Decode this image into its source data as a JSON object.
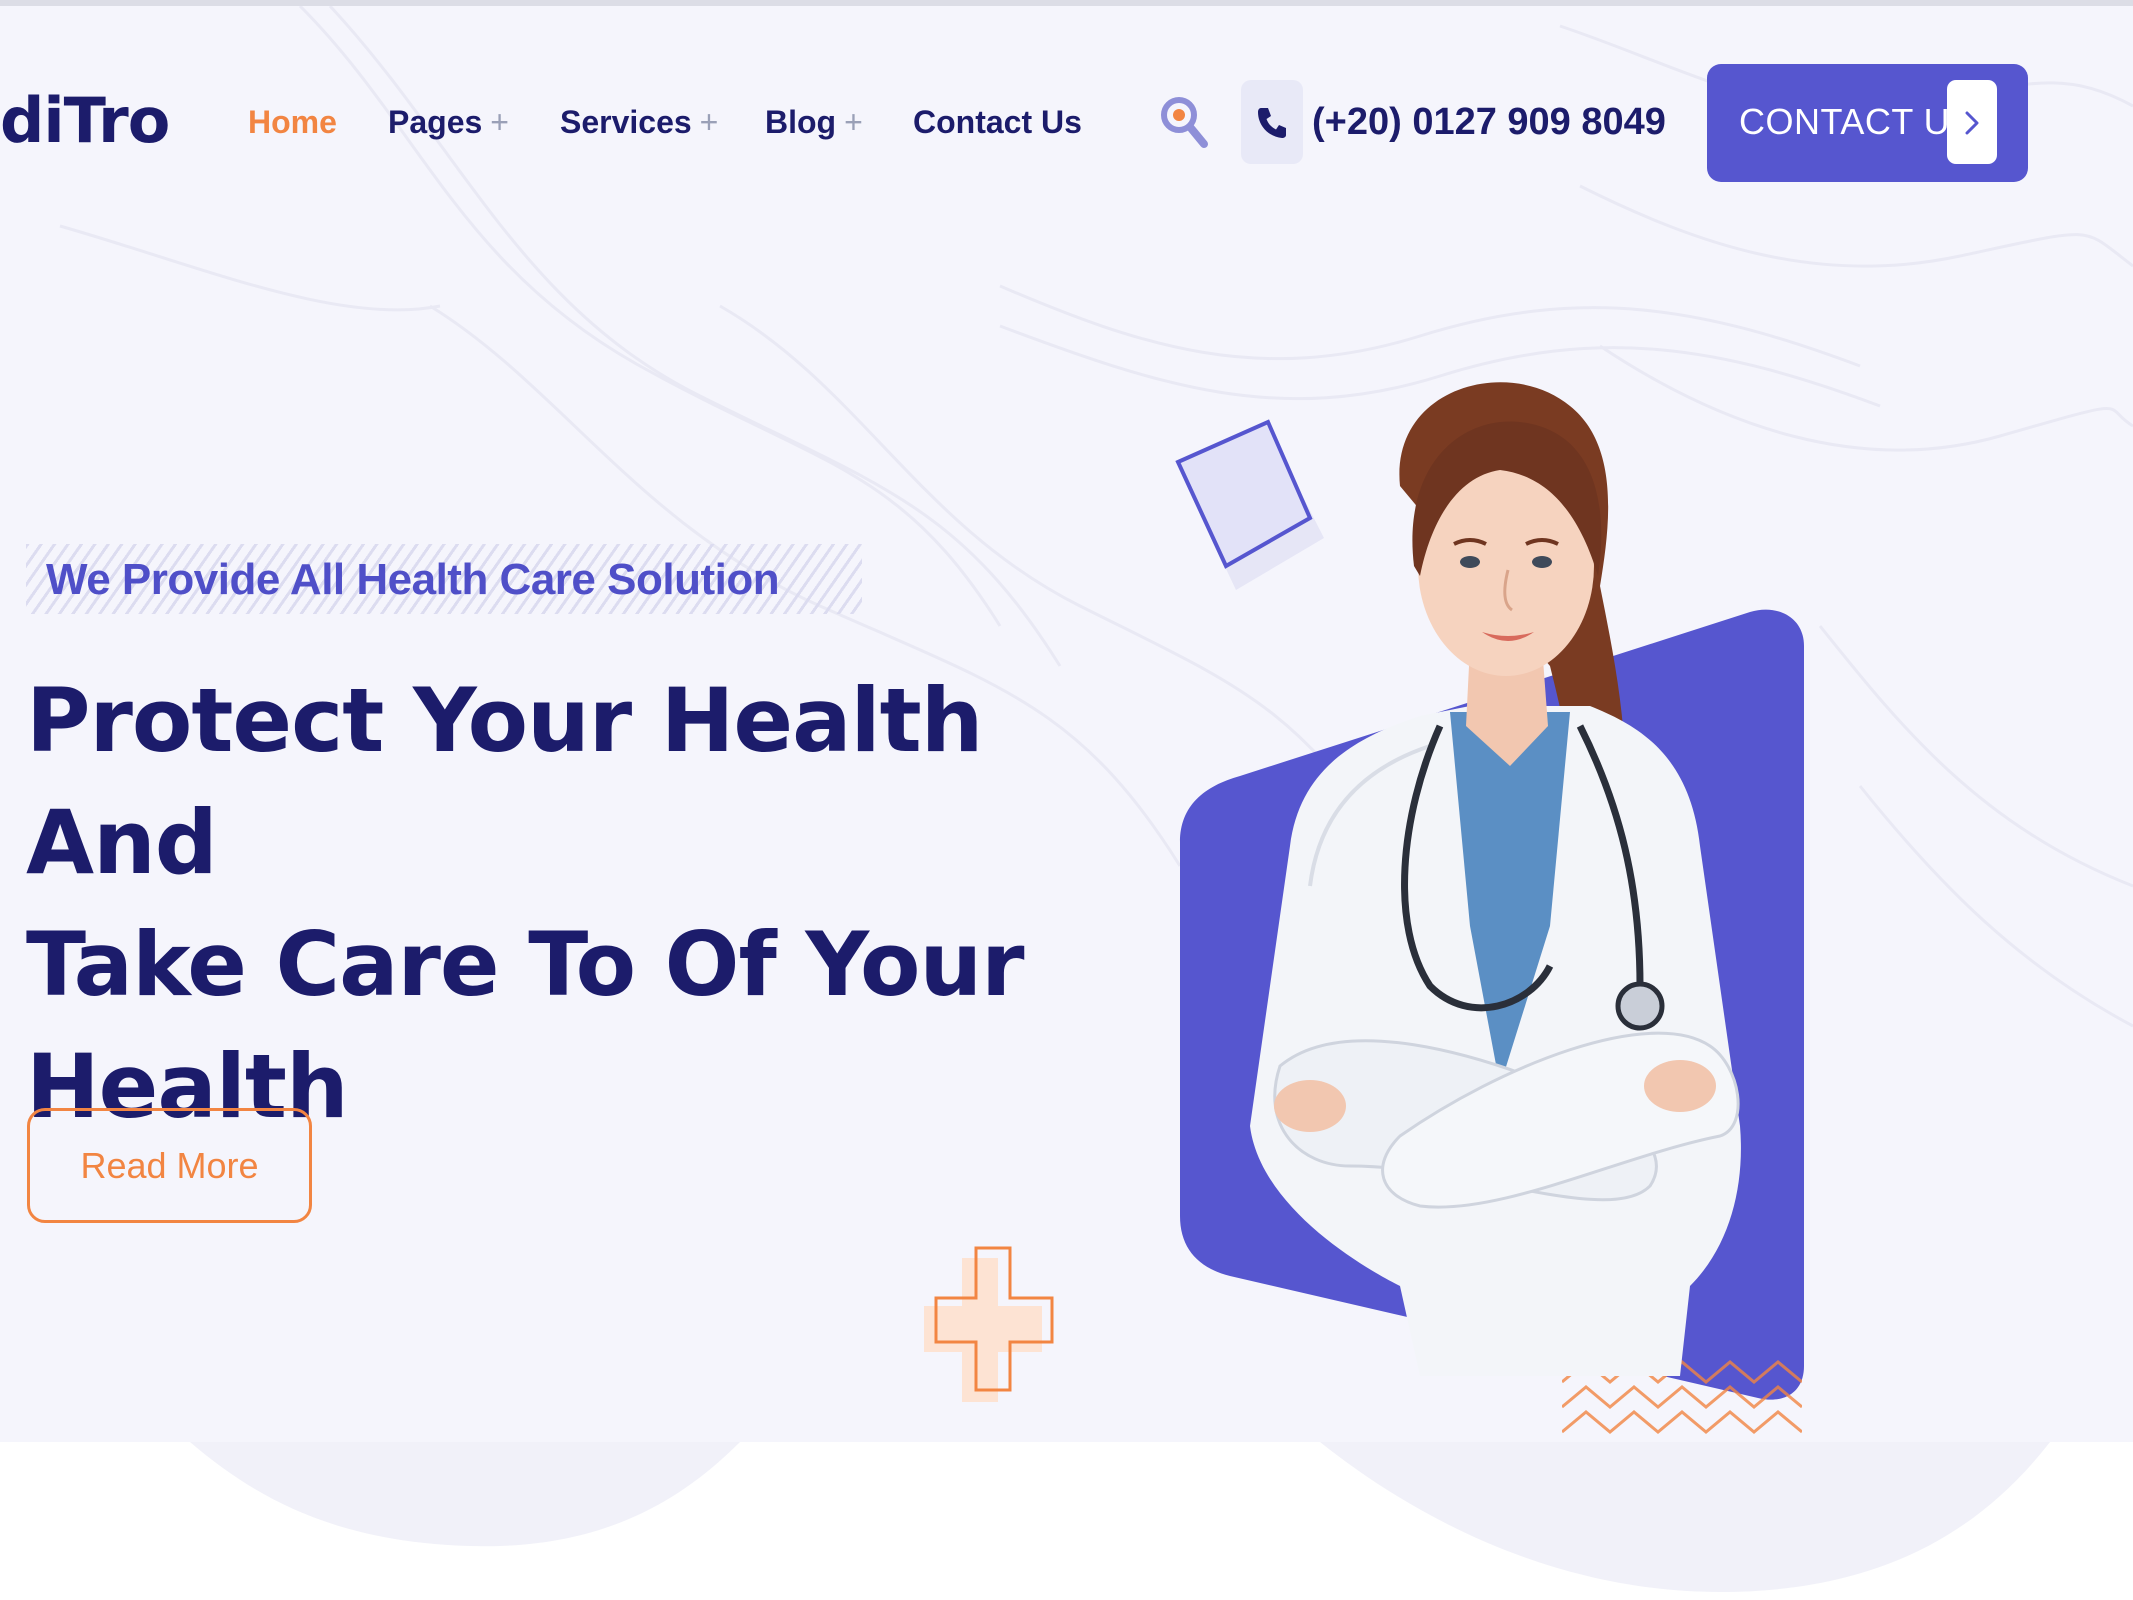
{
  "brand": {
    "logo_text": "diTro"
  },
  "nav": {
    "items": [
      {
        "label": "Home",
        "has_submenu": false,
        "active": true
      },
      {
        "label": "Pages",
        "has_submenu": true,
        "active": false
      },
      {
        "label": "Services",
        "has_submenu": true,
        "active": false
      },
      {
        "label": "Blog",
        "has_submenu": true,
        "active": false
      },
      {
        "label": "Contact Us",
        "has_submenu": false,
        "active": false
      }
    ],
    "submenu_symbol": "+"
  },
  "header": {
    "search_icon": "search-icon",
    "phone_icon": "phone-icon",
    "phone_number": "(+20) 0127 909 8049",
    "cta_label": "CONTACT US",
    "cta_icon": "chevron-right-icon"
  },
  "hero": {
    "tagline": "We Provide All Health Care Solution",
    "headline_lines": [
      "Protect Your Health And",
      "Take Care To Of Your",
      "Health"
    ],
    "read_more_label": "Read More",
    "image": "doctor-portrait"
  },
  "colors": {
    "primary": "#5656cf",
    "navy": "#1c1c6b",
    "accent": "#f28542",
    "hero_bg": "#f5f5fc",
    "tagline": "#4f4fc8"
  }
}
